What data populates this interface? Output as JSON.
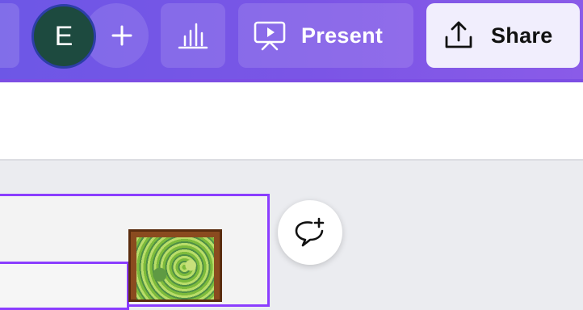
{
  "header": {
    "avatar_initial": "E",
    "present_label": "Present",
    "share_label": "Share"
  },
  "icons": {
    "add_collaborator": "plus-icon",
    "insights": "bar-chart-icon",
    "present": "presentation-screen-icon",
    "share": "upload-icon",
    "comment": "add-comment-icon"
  },
  "colors": {
    "header_bg": "#7b55e6",
    "avatar_bg": "#1d4a3f",
    "share_bg": "#f1eefd",
    "selection": "#8b3dff"
  }
}
